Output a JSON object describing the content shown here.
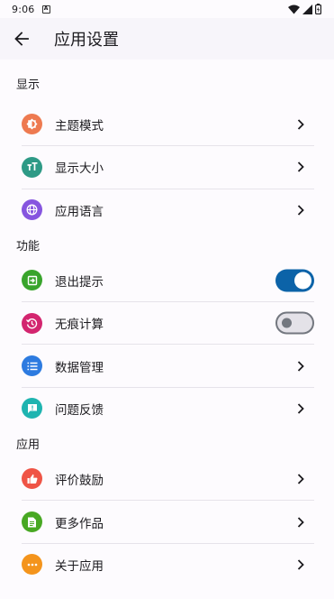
{
  "status_bar": {
    "time": "9:06",
    "notification_badge": "A"
  },
  "app_bar": {
    "title": "应用设置",
    "back_icon": "arrow-left-icon"
  },
  "sections": [
    {
      "title": "显示",
      "items": [
        {
          "label": "主题模式",
          "icon": "theme-icon",
          "color": "#ee7a50",
          "control": "chevron"
        },
        {
          "label": "显示大小",
          "icon": "text-size-icon",
          "color": "#2e9a86",
          "control": "chevron"
        },
        {
          "label": "应用语言",
          "icon": "globe-icon",
          "color": "#8655df",
          "control": "chevron"
        }
      ]
    },
    {
      "title": "功能",
      "items": [
        {
          "label": "退出提示",
          "icon": "exit-icon",
          "color": "#39a42c",
          "control": "toggle",
          "checked": true
        },
        {
          "label": "无痕计算",
          "icon": "history-icon",
          "color": "#d3256f",
          "control": "toggle",
          "checked": false
        },
        {
          "label": "数据管理",
          "icon": "list-icon",
          "color": "#2d7be0",
          "control": "chevron"
        },
        {
          "label": "问题反馈",
          "icon": "feedback-icon",
          "color": "#1eb4b0",
          "control": "chevron"
        }
      ]
    },
    {
      "title": "应用",
      "items": [
        {
          "label": "评价鼓励",
          "icon": "thumb-up-icon",
          "color": "#ef5446",
          "control": "chevron"
        },
        {
          "label": "更多作品",
          "icon": "document-icon",
          "color": "#48a823",
          "control": "chevron"
        },
        {
          "label": "关于应用",
          "icon": "more-icon",
          "color": "#f4941c",
          "control": "chevron"
        }
      ]
    }
  ]
}
